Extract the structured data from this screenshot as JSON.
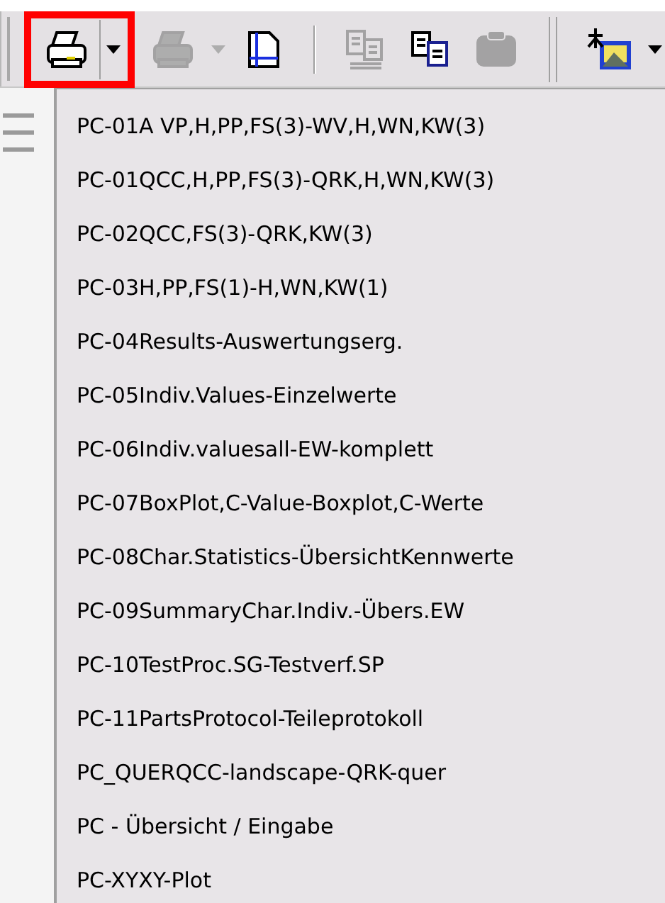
{
  "toolbar": {
    "print_group": {
      "highlighted": true,
      "items": [
        {
          "kind": "printer",
          "disabled": false
        },
        {
          "kind": "arrow",
          "disabled": false
        }
      ]
    },
    "items": [
      {
        "kind": "printer",
        "disabled": true
      },
      {
        "kind": "arrow",
        "disabled": true
      },
      {
        "kind": "page",
        "disabled": false
      },
      {
        "kind": "separator"
      },
      {
        "kind": "copy-csv",
        "disabled": true
      },
      {
        "kind": "copy",
        "disabled": false
      },
      {
        "kind": "paste",
        "disabled": true
      },
      {
        "kind": "grip"
      },
      {
        "kind": "picture-tool",
        "disabled": false
      },
      {
        "kind": "arrow",
        "disabled": false
      }
    ]
  },
  "menu": {
    "items": [
      "PC-01A VP,H,PP,FS(3)-WV,H,WN,KW(3)",
      "PC-01QCC,H,PP,FS(3)-QRK,H,WN,KW(3)",
      "PC-02QCC,FS(3)-QRK,KW(3)",
      "PC-03H,PP,FS(1)-H,WN,KW(1)",
      "PC-04Results-Auswertungserg.",
      "PC-05Indiv.Values-Einzelwerte",
      "PC-06Indiv.valuesall-EW-komplett",
      "PC-07BoxPlot,C-Value-Boxplot,C-Werte",
      "PC-08Char.Statistics-ÜbersichtKennwerte",
      "PC-09SummaryChar.Indiv.-Übers.EW",
      "PC-10TestProc.SG-Testverf.SP",
      "PC-11PartsProtocol-Teileprotokoll",
      "PC_QUERQCC-landscape-QRK-quer",
      "PC - Übersicht / Eingabe",
      "PC-XYXY-Plot"
    ]
  }
}
